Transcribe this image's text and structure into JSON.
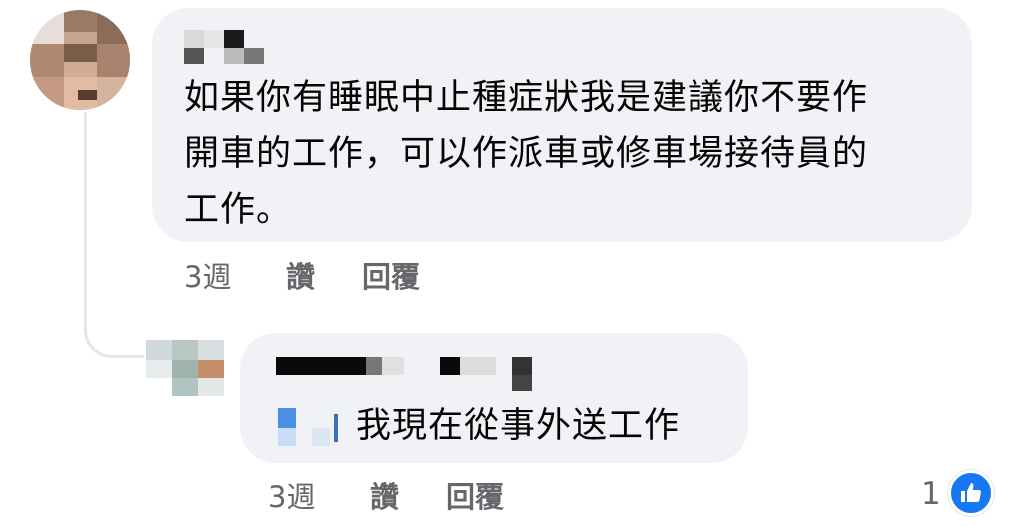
{
  "colors": {
    "bubble": "#f0f2f5",
    "action_text": "#65676b",
    "like_blue": "#1877f2"
  },
  "comment": {
    "text_lines": [
      "如果你有睡眠中止種症狀我是建議你不要作",
      "開車的工作，可以作派車或修車場接待員的",
      "工作。"
    ],
    "actions": {
      "time": "3週",
      "like": "讚",
      "reply": "回覆"
    }
  },
  "reply": {
    "text": "我現在從事外送工作",
    "actions": {
      "time": "3週",
      "like": "讚",
      "reply": "回覆"
    },
    "reaction_count": "1",
    "reaction_icon": "thumbs-up-icon"
  }
}
